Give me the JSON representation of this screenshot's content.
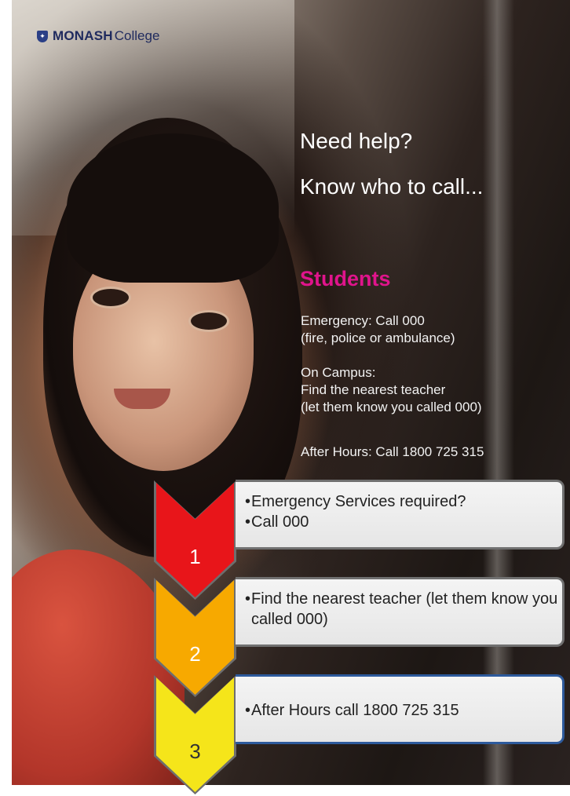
{
  "brand": {
    "name_bold": "MONASH",
    "name_regular": "College",
    "crest_icon": "monash-crest-icon"
  },
  "headline": {
    "line1": "Need help?",
    "line2": "Know who to call..."
  },
  "section_title": "Students",
  "info": {
    "emergency_line1": "Emergency: Call 000",
    "emergency_line2": "(fire, police or ambulance)",
    "campus_line1": "On Campus:",
    "campus_line2": "Find the nearest teacher",
    "campus_line3": "(let them know you called 000)",
    "after_hours": "After Hours: Call 1800 725 315"
  },
  "steps": [
    {
      "number": "1",
      "color": "#e8151a",
      "bullets": [
        "Emergency Services required?",
        "Call 000"
      ]
    },
    {
      "number": "2",
      "color": "#f7a900",
      "bullets": [
        "Find the nearest teacher (let them know you called 000)"
      ]
    },
    {
      "number": "3",
      "color": "#f5e51a",
      "bullets": [
        "After Hours call 1800 725 315"
      ]
    }
  ],
  "colors": {
    "accent_pink": "#e0148c",
    "brand_navy": "#1f2a5e",
    "box_border": "#707070",
    "box3_border": "#2d5a9c"
  }
}
